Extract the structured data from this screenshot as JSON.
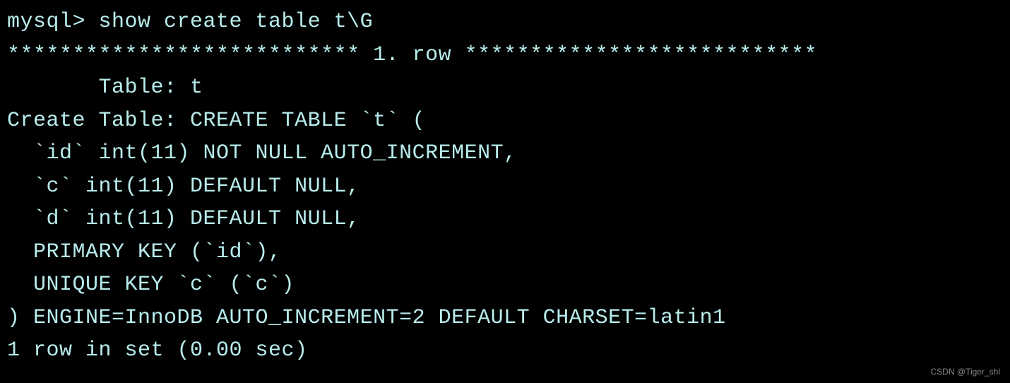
{
  "terminal": {
    "promptLine": "mysql> show create table t\\G",
    "separator": "*************************** 1. row ***************************",
    "tableLine": "       Table: t",
    "createTableHeader": "Create Table: CREATE TABLE `t` (",
    "columns": {
      "id": "  `id` int(11) NOT NULL AUTO_INCREMENT,",
      "c": "  `c` int(11) DEFAULT NULL,",
      "d": "  `d` int(11) DEFAULT NULL,"
    },
    "primaryKey": "  PRIMARY KEY (`id`),",
    "uniqueKey": "  UNIQUE KEY `c` (`c`)",
    "engineLine": ") ENGINE=InnoDB AUTO_INCREMENT=2 DEFAULT CHARSET=latin1",
    "resultLine": "1 row in set (0.00 sec)"
  },
  "watermark": "CSDN @Tiger_shl"
}
